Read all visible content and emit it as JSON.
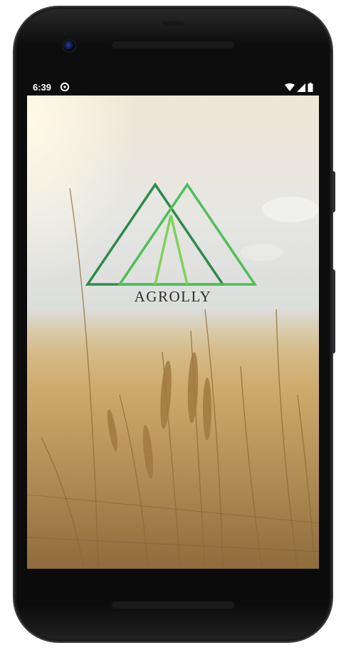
{
  "status_bar": {
    "time": "6:39",
    "icons": [
      "sync-icon",
      "wifi-icon",
      "signal-icon",
      "battery-icon"
    ]
  },
  "splash": {
    "brand_name": "AGROLLY",
    "logo_colors": [
      "#2e8b4a",
      "#4fbf5a",
      "#7fd15a"
    ],
    "background": "wheat-field"
  }
}
